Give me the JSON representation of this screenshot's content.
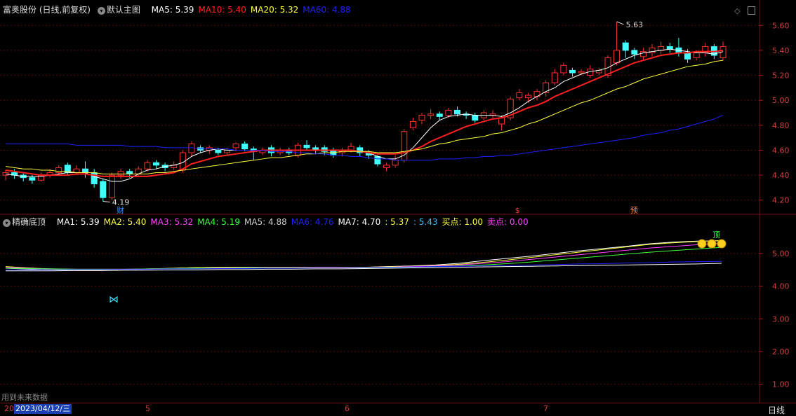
{
  "main_panel": {
    "title": "富奥股份 (日线,前复权)",
    "indicator_name": "默认主图",
    "ma": [
      {
        "label": "MA5: 5.39",
        "color": "#ffffff"
      },
      {
        "label": "MA10: 5.40",
        "color": "#ff2020"
      },
      {
        "label": "MA20: 5.32",
        "color": "#ffff40"
      },
      {
        "label": "MA60: 4.88",
        "color": "#2020ff"
      }
    ],
    "price_axis": [
      "5.60",
      "5.40",
      "5.20",
      "5.00",
      "4.80",
      "4.60",
      "4.40",
      "4.20"
    ],
    "high_annotation": "5.63",
    "low_annotation": "4.19",
    "markers": [
      {
        "text": "财",
        "color": "#3a8cff"
      },
      {
        "text": "$",
        "color": "#ff3030"
      },
      {
        "text": "预",
        "color": "#ff8040"
      }
    ],
    "colors": {
      "up": "#ff3030",
      "down": "#40ffff"
    }
  },
  "sub_panel": {
    "indicator_name": "精确底顶",
    "items": [
      {
        "label": "MA1: 5.39",
        "color": "#ffffff"
      },
      {
        "label": "MA2: 5.40",
        "color": "#ffff40"
      },
      {
        "label": "MA3: 5.32",
        "color": "#ff40ff"
      },
      {
        "label": "MA4: 5.19",
        "color": "#40ff40"
      },
      {
        "label": "MA5: 4.88",
        "color": "#cccccc"
      },
      {
        "label": "MA6: 4.76",
        "color": "#2020ff"
      },
      {
        "label": "MA7: 4.70",
        "color": "#ffffff"
      },
      {
        "label": ": 5.37",
        "color": "#ffff40"
      },
      {
        "label": ": 5.43",
        "color": "#40c0ff"
      },
      {
        "label": "买点: 1.00",
        "color": "#ffff40"
      },
      {
        "label": "卖点: 0.00",
        "color": "#ff40ff"
      }
    ],
    "axis": [
      "5.00",
      "4.00",
      "3.00",
      "2.00",
      "1.00"
    ],
    "top_marker": "顶",
    "footer_note": "用到未来数据"
  },
  "bottom_bar": {
    "date_cursor": "2023/04/12/三",
    "first_tick": "20",
    "month_ticks": [
      "5",
      "6",
      "7"
    ],
    "period": "日线"
  },
  "chart_data": {
    "type": "candlestick",
    "title": "富奥股份 (日线,前复权)",
    "ylim": [
      4.12,
      5.68
    ],
    "high": 5.63,
    "low": 4.19,
    "candles": [
      [
        4.4,
        4.42,
        4.36,
        4.44
      ],
      [
        4.42,
        4.4,
        4.37,
        4.45
      ],
      [
        4.4,
        4.38,
        4.35,
        4.42
      ],
      [
        4.38,
        4.36,
        4.33,
        4.4
      ],
      [
        4.36,
        4.4,
        4.35,
        4.42
      ],
      [
        4.4,
        4.42,
        4.38,
        4.45
      ],
      [
        4.42,
        4.46,
        4.4,
        4.48
      ],
      [
        4.48,
        4.42,
        4.4,
        4.5
      ],
      [
        4.42,
        4.45,
        4.4,
        4.48
      ],
      [
        4.45,
        4.42,
        4.38,
        4.51
      ],
      [
        4.42,
        4.33,
        4.3,
        4.45
      ],
      [
        4.35,
        4.22,
        4.19,
        4.37
      ],
      [
        4.22,
        4.4,
        4.2,
        4.42
      ],
      [
        4.4,
        4.43,
        4.37,
        4.45
      ],
      [
        4.43,
        4.41,
        4.38,
        4.45
      ],
      [
        4.41,
        4.45,
        4.39,
        4.47
      ],
      [
        4.45,
        4.5,
        4.43,
        4.52
      ],
      [
        4.5,
        4.48,
        4.45,
        4.52
      ],
      [
        4.48,
        4.46,
        4.43,
        4.5
      ],
      [
        4.46,
        4.48,
        4.44,
        4.51
      ],
      [
        4.44,
        4.58,
        4.42,
        4.6
      ],
      [
        4.58,
        4.65,
        4.55,
        4.67
      ],
      [
        4.62,
        4.6,
        4.58,
        4.64
      ],
      [
        4.6,
        4.62,
        4.57,
        4.64
      ],
      [
        4.6,
        4.58,
        4.56,
        4.62
      ],
      [
        4.58,
        4.6,
        4.56,
        4.62
      ],
      [
        4.62,
        4.65,
        4.59,
        4.66
      ],
      [
        4.65,
        4.61,
        4.59,
        4.67
      ],
      [
        4.61,
        4.59,
        4.52,
        4.63
      ],
      [
        4.58,
        4.6,
        4.56,
        4.62
      ],
      [
        4.62,
        4.58,
        4.55,
        4.64
      ],
      [
        4.58,
        4.6,
        4.56,
        4.62
      ],
      [
        4.6,
        4.58,
        4.56,
        4.62
      ],
      [
        4.56,
        4.64,
        4.54,
        4.66
      ],
      [
        4.64,
        4.62,
        4.6,
        4.68
      ],
      [
        4.62,
        4.6,
        4.57,
        4.64
      ],
      [
        4.62,
        4.59,
        4.56,
        4.64
      ],
      [
        4.6,
        4.56,
        4.54,
        4.62
      ],
      [
        4.58,
        4.6,
        4.55,
        4.62
      ],
      [
        4.6,
        4.63,
        4.58,
        4.66
      ],
      [
        4.62,
        4.58,
        4.55,
        4.64
      ],
      [
        4.58,
        4.56,
        4.53,
        4.6
      ],
      [
        4.55,
        4.49,
        4.47,
        4.56
      ],
      [
        4.46,
        4.48,
        4.43,
        4.5
      ],
      [
        4.48,
        4.52,
        4.46,
        4.56
      ],
      [
        4.52,
        4.75,
        4.5,
        4.77
      ],
      [
        4.78,
        4.83,
        4.76,
        4.86
      ],
      [
        4.84,
        4.88,
        4.81,
        4.9
      ],
      [
        4.88,
        4.89,
        4.85,
        4.93
      ],
      [
        4.89,
        4.87,
        4.84,
        4.91
      ],
      [
        4.88,
        4.92,
        4.86,
        4.94
      ],
      [
        4.92,
        4.89,
        4.87,
        4.95
      ],
      [
        4.89,
        4.88,
        4.85,
        4.91
      ],
      [
        4.88,
        4.84,
        4.82,
        4.9
      ],
      [
        4.86,
        4.9,
        4.84,
        4.92
      ],
      [
        4.88,
        4.89,
        4.86,
        4.92
      ],
      [
        4.81,
        4.86,
        4.76,
        4.88
      ],
      [
        4.86,
        5.01,
        4.84,
        5.03
      ],
      [
        5.02,
        5.06,
        5.0,
        5.09
      ],
      [
        5.02,
        5.04,
        4.98,
        5.06
      ],
      [
        5.03,
        5.07,
        5.0,
        5.09
      ],
      [
        5.06,
        5.14,
        5.03,
        5.16
      ],
      [
        5.14,
        5.22,
        5.12,
        5.25
      ],
      [
        5.22,
        5.28,
        5.2,
        5.3
      ],
      [
        5.24,
        5.22,
        5.19,
        5.26
      ],
      [
        5.22,
        5.23,
        5.2,
        5.25
      ],
      [
        5.2,
        5.25,
        5.18,
        5.28
      ],
      [
        5.22,
        5.24,
        5.2,
        5.26
      ],
      [
        5.2,
        5.34,
        5.18,
        5.36
      ],
      [
        5.3,
        5.4,
        5.28,
        5.63
      ],
      [
        5.46,
        5.4,
        5.34,
        5.48
      ],
      [
        5.4,
        5.37,
        5.33,
        5.42
      ],
      [
        5.35,
        5.39,
        5.32,
        5.42
      ],
      [
        5.38,
        5.42,
        5.35,
        5.45
      ],
      [
        5.4,
        5.43,
        5.37,
        5.47
      ],
      [
        5.43,
        5.41,
        5.38,
        5.46
      ],
      [
        5.42,
        5.38,
        5.35,
        5.5
      ],
      [
        5.38,
        5.33,
        5.3,
        5.41
      ],
      [
        5.34,
        5.38,
        5.32,
        5.4
      ],
      [
        5.38,
        5.43,
        5.35,
        5.46
      ],
      [
        5.43,
        5.36,
        5.33,
        5.45
      ],
      [
        5.34,
        5.43,
        5.32,
        5.47
      ]
    ],
    "ma_series": [
      {
        "name": "MA5",
        "color": "#ffffff",
        "values": [
          4.41,
          4.4,
          4.39,
          4.39,
          4.39,
          4.4,
          4.41,
          4.42,
          4.42,
          4.42,
          4.39,
          4.37,
          4.35,
          4.35,
          4.37,
          4.41,
          4.44,
          4.45,
          4.47,
          4.48,
          4.5,
          4.55,
          4.58,
          4.6,
          4.61,
          4.6,
          4.6,
          4.6,
          4.6,
          4.6,
          4.6,
          4.6,
          4.6,
          4.6,
          4.6,
          4.6,
          4.6,
          4.6,
          4.6,
          4.6,
          4.59,
          4.58,
          4.55,
          4.53,
          4.53,
          4.56,
          4.62,
          4.7,
          4.78,
          4.84,
          4.87,
          4.88,
          4.89,
          4.88,
          4.88,
          4.88,
          4.87,
          4.9,
          4.94,
          4.99,
          5.03,
          5.07,
          5.1,
          5.15,
          5.18,
          5.21,
          5.23,
          5.24,
          5.26,
          5.3,
          5.33,
          5.36,
          5.38,
          5.39,
          5.4,
          5.41,
          5.4,
          5.39,
          5.38,
          5.38,
          5.37,
          5.39
        ]
      },
      {
        "name": "MA10",
        "color": "#ff2020",
        "values": [
          4.44,
          4.43,
          4.42,
          4.41,
          4.4,
          4.4,
          4.4,
          4.4,
          4.41,
          4.41,
          4.4,
          4.39,
          4.39,
          4.39,
          4.39,
          4.39,
          4.39,
          4.4,
          4.41,
          4.42,
          4.45,
          4.49,
          4.51,
          4.53,
          4.55,
          4.56,
          4.57,
          4.58,
          4.59,
          4.6,
          4.6,
          4.6,
          4.6,
          4.6,
          4.6,
          4.6,
          4.6,
          4.6,
          4.6,
          4.6,
          4.59,
          4.58,
          4.57,
          4.57,
          4.57,
          4.58,
          4.6,
          4.63,
          4.67,
          4.7,
          4.73,
          4.76,
          4.79,
          4.81,
          4.83,
          4.85,
          4.86,
          4.88,
          4.91,
          4.94,
          4.96,
          4.99,
          5.03,
          5.06,
          5.09,
          5.12,
          5.15,
          5.18,
          5.21,
          5.24,
          5.27,
          5.3,
          5.32,
          5.34,
          5.36,
          5.37,
          5.38,
          5.38,
          5.39,
          5.39,
          5.39,
          5.4
        ]
      },
      {
        "name": "MA20",
        "color": "#ffff40",
        "values": [
          4.47,
          4.46,
          4.45,
          4.45,
          4.44,
          4.44,
          4.43,
          4.43,
          4.42,
          4.42,
          4.42,
          4.41,
          4.41,
          4.41,
          4.41,
          4.41,
          4.41,
          4.42,
          4.42,
          4.43,
          4.44,
          4.45,
          4.46,
          4.47,
          4.48,
          4.49,
          4.5,
          4.51,
          4.52,
          4.53,
          4.54,
          4.54,
          4.55,
          4.56,
          4.57,
          4.57,
          4.58,
          4.58,
          4.59,
          4.59,
          4.59,
          4.59,
          4.58,
          4.58,
          4.58,
          4.59,
          4.6,
          4.61,
          4.63,
          4.65,
          4.66,
          4.68,
          4.69,
          4.7,
          4.71,
          4.73,
          4.74,
          4.76,
          4.78,
          4.81,
          4.83,
          4.86,
          4.89,
          4.92,
          4.95,
          4.98,
          5.0,
          5.03,
          5.06,
          5.09,
          5.11,
          5.14,
          5.17,
          5.19,
          5.21,
          5.23,
          5.25,
          5.27,
          5.28,
          5.29,
          5.31,
          5.32
        ]
      },
      {
        "name": "MA60",
        "color": "#2020ff",
        "values": [
          4.65,
          4.65,
          4.65,
          4.65,
          4.65,
          4.65,
          4.65,
          4.65,
          4.64,
          4.64,
          4.64,
          4.64,
          4.64,
          4.64,
          4.63,
          4.63,
          4.63,
          4.63,
          4.62,
          4.62,
          4.62,
          4.62,
          4.61,
          4.61,
          4.61,
          4.61,
          4.6,
          4.6,
          4.6,
          4.6,
          4.59,
          4.59,
          4.59,
          4.58,
          4.58,
          4.57,
          4.57,
          4.56,
          4.56,
          4.55,
          4.55,
          4.54,
          4.53,
          4.53,
          4.52,
          4.52,
          4.52,
          4.52,
          4.52,
          4.53,
          4.53,
          4.53,
          4.54,
          4.54,
          4.55,
          4.55,
          4.56,
          4.56,
          4.57,
          4.58,
          4.59,
          4.6,
          4.61,
          4.62,
          4.63,
          4.64,
          4.65,
          4.66,
          4.67,
          4.68,
          4.69,
          4.7,
          4.72,
          4.73,
          4.74,
          4.76,
          4.77,
          4.79,
          4.81,
          4.83,
          4.85,
          4.88
        ]
      }
    ],
    "sub_ylim": [
      0.5,
      5.9
    ],
    "sub_series": [
      {
        "name": "MA1",
        "color": "#ffffff",
        "values": [
          4.55,
          4.52,
          4.5,
          4.48,
          4.48,
          4.5,
          4.52,
          4.55,
          4.57,
          4.58,
          4.58,
          4.58,
          4.58,
          4.58,
          4.58,
          4.58,
          4.6,
          4.62,
          4.65,
          4.7,
          4.78,
          4.85,
          4.92,
          5.0,
          5.08,
          5.15,
          5.22,
          5.3,
          5.35,
          5.38,
          5.39
        ]
      },
      {
        "name": "MA2",
        "color": "#ffff40",
        "values": [
          4.6,
          4.56,
          4.52,
          4.5,
          4.5,
          4.51,
          4.53,
          4.55,
          4.57,
          4.58,
          4.58,
          4.58,
          4.58,
          4.58,
          4.58,
          4.58,
          4.59,
          4.61,
          4.63,
          4.67,
          4.73,
          4.8,
          4.88,
          4.96,
          5.04,
          5.12,
          5.2,
          5.28,
          5.33,
          5.37,
          5.4
        ]
      },
      {
        "name": "MA3",
        "color": "#ff40ff",
        "values": [
          4.58,
          4.55,
          4.53,
          4.52,
          4.52,
          4.52,
          4.53,
          4.54,
          4.55,
          4.56,
          4.57,
          4.57,
          4.57,
          4.57,
          4.57,
          4.57,
          4.58,
          4.6,
          4.62,
          4.65,
          4.7,
          4.75,
          4.82,
          4.89,
          4.96,
          5.03,
          5.1,
          5.17,
          5.22,
          5.27,
          5.32
        ]
      },
      {
        "name": "MA4",
        "color": "#40ff40",
        "values": [
          4.55,
          4.54,
          4.53,
          4.52,
          4.52,
          4.52,
          4.53,
          4.54,
          4.55,
          4.55,
          4.56,
          4.56,
          4.56,
          4.56,
          4.56,
          4.56,
          4.57,
          4.58,
          4.6,
          4.62,
          4.65,
          4.69,
          4.74,
          4.8,
          4.86,
          4.92,
          4.98,
          5.04,
          5.09,
          5.14,
          5.19
        ]
      },
      {
        "name": "MA6",
        "color": "#2020ff",
        "values": [
          4.5,
          4.5,
          4.5,
          4.51,
          4.51,
          4.52,
          4.52,
          4.53,
          4.53,
          4.54,
          4.54,
          4.55,
          4.55,
          4.56,
          4.56,
          4.57,
          4.58,
          4.59,
          4.6,
          4.61,
          4.62,
          4.63,
          4.65,
          4.66,
          4.68,
          4.69,
          4.71,
          4.72,
          4.74,
          4.75,
          4.76
        ]
      },
      {
        "name": "MA7",
        "color": "#ffffff",
        "values": [
          4.47,
          4.47,
          4.47,
          4.48,
          4.48,
          4.49,
          4.49,
          4.5,
          4.5,
          4.51,
          4.51,
          4.52,
          4.52,
          4.53,
          4.53,
          4.54,
          4.55,
          4.56,
          4.57,
          4.58,
          4.59,
          4.6,
          4.61,
          4.62,
          4.63,
          4.64,
          4.65,
          4.66,
          4.67,
          4.68,
          4.7
        ]
      }
    ]
  }
}
